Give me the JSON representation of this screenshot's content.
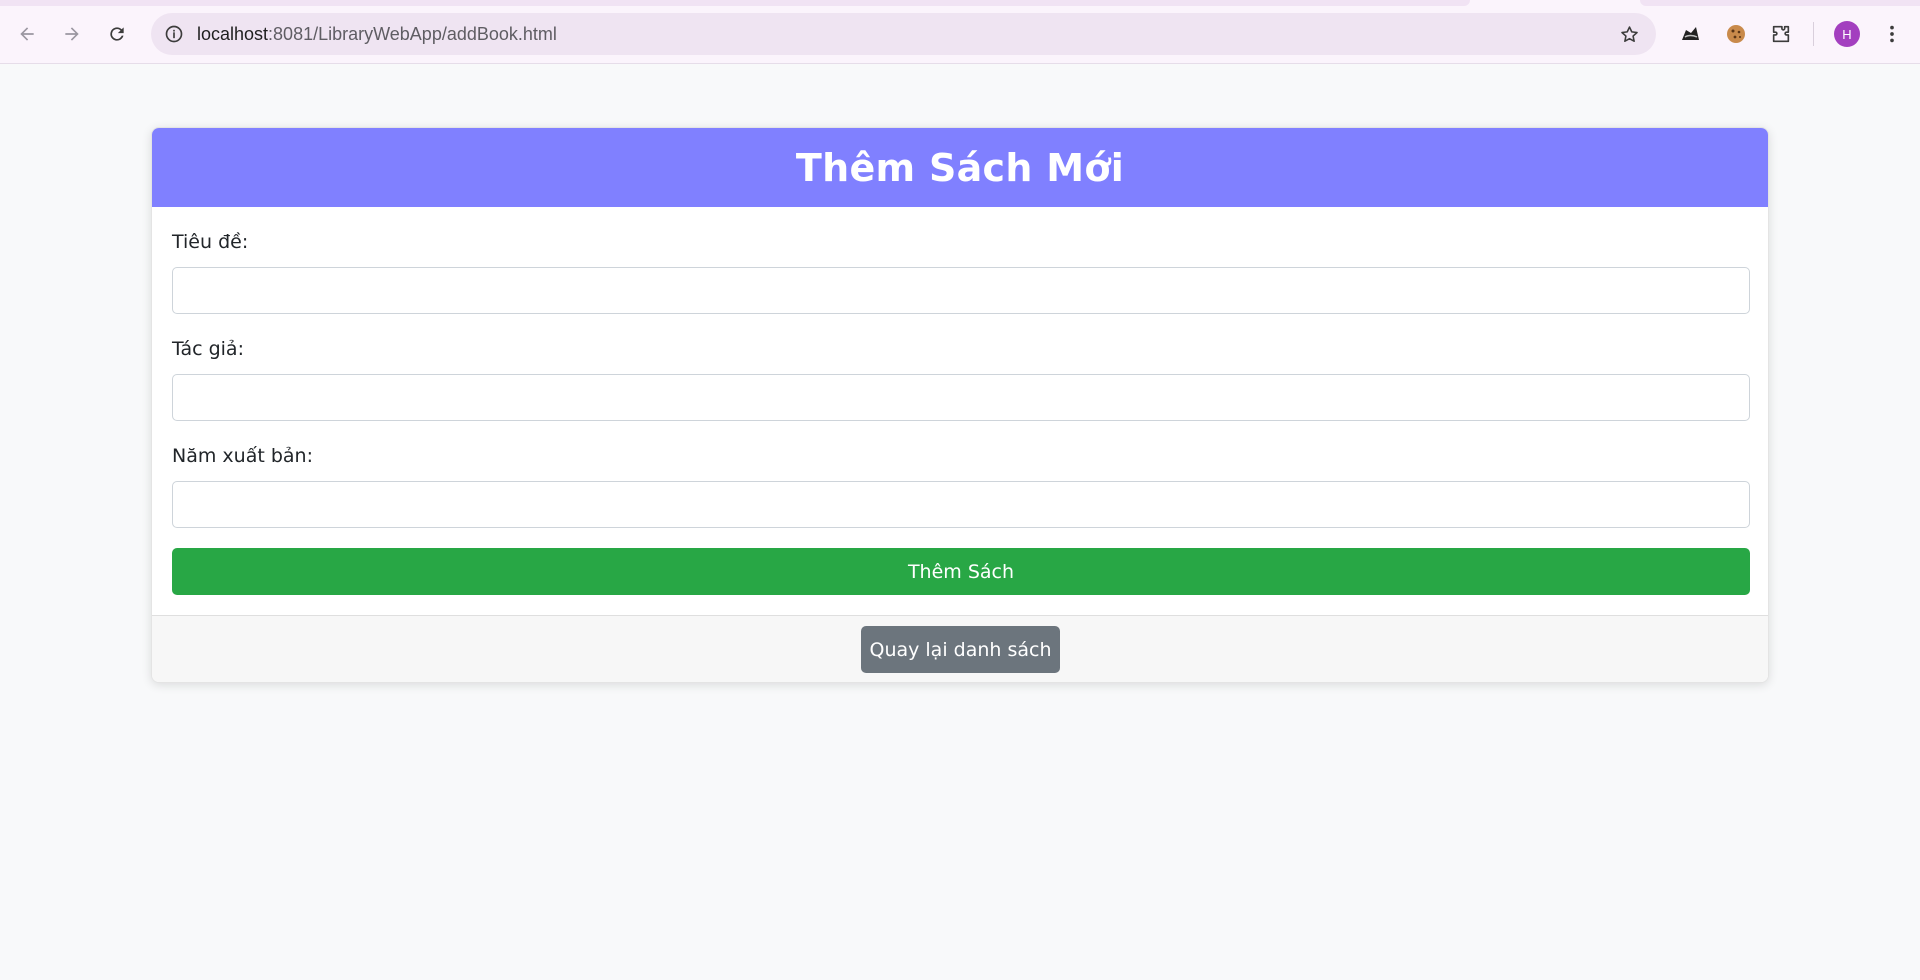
{
  "browser": {
    "url_host": "localhost",
    "url_rest": ":8081/LibraryWebApp/addBook.html",
    "avatar_initial": "H",
    "icons": [
      "back-icon",
      "forward-icon",
      "reload-icon",
      "site-info-icon",
      "bookmark-star-icon",
      "extension-hat-icon",
      "cookie-extension-icon",
      "extensions-puzzle-icon",
      "menu-dots-icon"
    ]
  },
  "page": {
    "title": "Thêm Sách Mới",
    "fields": [
      {
        "label": "Tiêu đề:",
        "value": "",
        "placeholder": ""
      },
      {
        "label": "Tác giả:",
        "value": "",
        "placeholder": ""
      },
      {
        "label": "Năm xuất bản:",
        "value": "",
        "placeholder": ""
      }
    ],
    "submit_label": "Thêm Sách",
    "back_label": "Quay lại danh sách"
  },
  "colors": {
    "header_bg": "#8080ff",
    "submit_bg": "#28a745",
    "back_bg": "#6c757d",
    "avatar_bg": "#a33fbf"
  }
}
